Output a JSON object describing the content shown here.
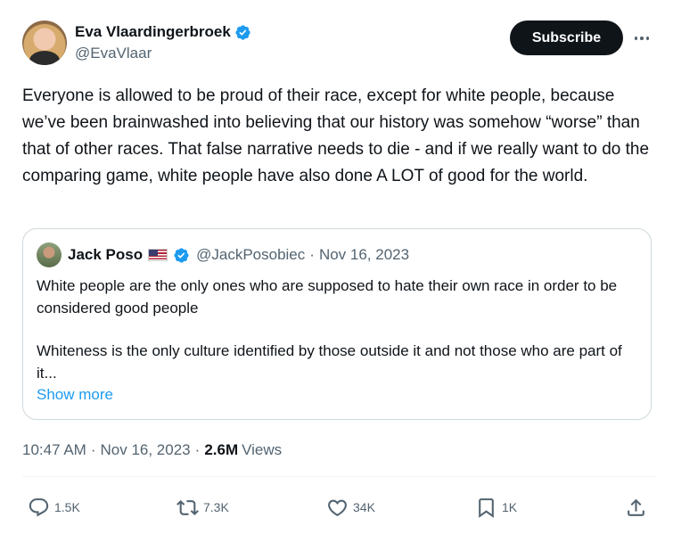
{
  "tweet": {
    "author_name": "Eva Vlaardingerbroek",
    "author_handle": "@EvaVlaar",
    "subscribe_label": "Subscribe",
    "text": "Everyone is allowed to be proud of their race, except for white people, because we’ve been brainwashed into believing that our history was somehow “worse” than that of other races. That false narrative needs to die - and if we really want to do the comparing game, white people have also done A LOT of good for the world.",
    "time": "10:47 AM",
    "date": "Nov 16, 2023",
    "views_count": "2.6M",
    "views_label": "Views"
  },
  "quote": {
    "author_name": "Jack Poso",
    "author_handle": "@JackPosobiec",
    "date": "Nov 16, 2023",
    "paragraph_1": "White people are the only ones who are supposed to hate their own race in order to be considered good people",
    "paragraph_2": "Whiteness is the only culture identified by those outside it and not those who are part of it...",
    "show_more": "Show more"
  },
  "actions": {
    "replies": "1.5K",
    "reposts": "7.3K",
    "likes": "34K",
    "bookmarks": "1K"
  },
  "colors": {
    "verified_badge": "#1d9bf0",
    "link": "#1d9bf0",
    "secondary_text": "#536471",
    "button_bg": "#0f1419"
  },
  "icons": [
    "verified-badge-icon",
    "more-icon",
    "reply-icon",
    "repost-icon",
    "like-icon",
    "bookmark-icon",
    "share-icon",
    "us-flag-icon"
  ]
}
